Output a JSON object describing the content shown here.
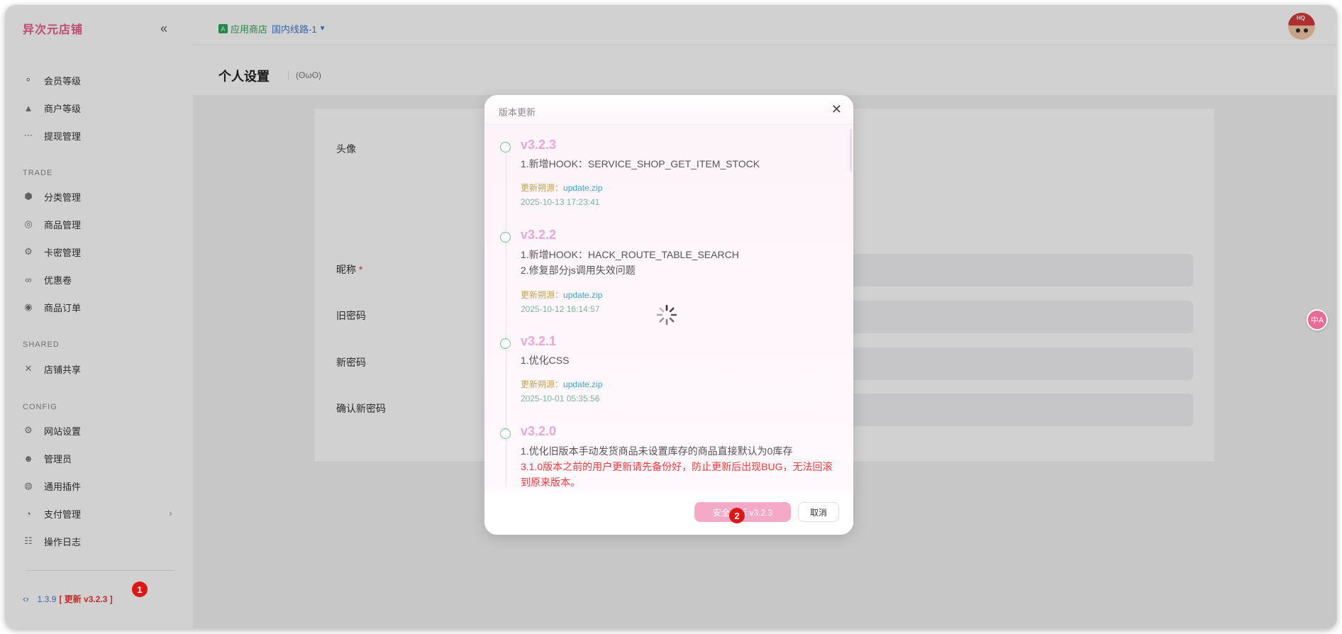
{
  "sidebar": {
    "brand": "异次元店铺",
    "items_top": [
      {
        "label": "会员等级",
        "icon": "share-icon"
      },
      {
        "label": "商户等级",
        "icon": "rocket-icon"
      },
      {
        "label": "提现管理",
        "icon": "ellipsis-icon"
      }
    ],
    "trade_title": "TRADE",
    "trade_items": [
      {
        "label": "分类管理",
        "icon": "cube-icon"
      },
      {
        "label": "商品管理",
        "icon": "swirl-icon"
      },
      {
        "label": "卡密管理",
        "icon": "gear-icon"
      },
      {
        "label": "优惠卷",
        "icon": "link-icon"
      },
      {
        "label": "商品订单",
        "icon": "coin-icon"
      }
    ],
    "shared_title": "SHARED",
    "shared_items": [
      {
        "label": "店铺共享",
        "icon": "tools-icon"
      }
    ],
    "config_title": "CONFIG",
    "config_items": [
      {
        "label": "网站设置",
        "icon": "gear-icon"
      },
      {
        "label": "管理员",
        "icon": "users-icon"
      },
      {
        "label": "通用插件",
        "icon": "plugin-icon"
      },
      {
        "label": "支付管理",
        "icon": "pie-icon"
      },
      {
        "label": "操作日志",
        "icon": "log-icon"
      }
    ],
    "version": "1.3.9",
    "update_label": "[ 更新 v3.2.3 ]"
  },
  "topbar": {
    "store_label": "应用商店",
    "route_label": "国内线路-1"
  },
  "page": {
    "title": "个人设置",
    "face": "(ʘωʘ)"
  },
  "form": {
    "avatar_label": "头像",
    "nickname_label": "昵称",
    "old_password_label": "旧密码",
    "new_password_label": "新密码",
    "confirm_password_label": "确认新密码"
  },
  "dialog": {
    "title": "版本更新",
    "source_key": "更新朔源：",
    "entries": [
      {
        "version": "v3.2.3",
        "lines": [
          "1.新增HOOK：SERVICE_SHOP_GET_ITEM_STOCK"
        ],
        "source": "update.zip",
        "date": "2025-10-13 17:23:41"
      },
      {
        "version": "v3.2.2",
        "lines": [
          "1.新增HOOK：HACK_ROUTE_TABLE_SEARCH",
          "2.修复部分js调用失效问题"
        ],
        "source": "update.zip",
        "date": "2025-10-12 16:14:57"
      },
      {
        "version": "v3.2.1",
        "lines": [
          "1.优化CSS"
        ],
        "source": "update.zip",
        "date": "2025-10-01 05:35:56"
      },
      {
        "version": "v3.2.0",
        "lines": [
          "1.优化旧版本手动发货商品未设置库存的商品直接默认为0库存"
        ],
        "warning": [
          "3.1.0版本之前的用户更新请先备份好，防止更新后出现BUG，无法回滚",
          "到原来版本。"
        ]
      }
    ],
    "primary_button": "安全更新 v3.2.3",
    "cancel_button": "取消"
  },
  "badges": {
    "one": "1",
    "two": "2"
  },
  "translate_label": "中A"
}
